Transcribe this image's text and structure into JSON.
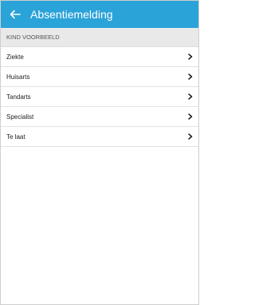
{
  "header": {
    "title": "Absentiemelding",
    "back_icon": "arrow-left-icon",
    "background_color": "#2aa3d9",
    "text_color": "#ffffff"
  },
  "section": {
    "label": "KIND VOORBEELD"
  },
  "items": [
    {
      "label": "Ziekte",
      "icon": "chevron-right-icon"
    },
    {
      "label": "Huisarts",
      "icon": "chevron-right-icon"
    },
    {
      "label": "Tandarts",
      "icon": "chevron-right-icon"
    },
    {
      "label": "Specialist",
      "icon": "chevron-right-icon"
    },
    {
      "label": "Te laat",
      "icon": "chevron-right-icon"
    }
  ]
}
